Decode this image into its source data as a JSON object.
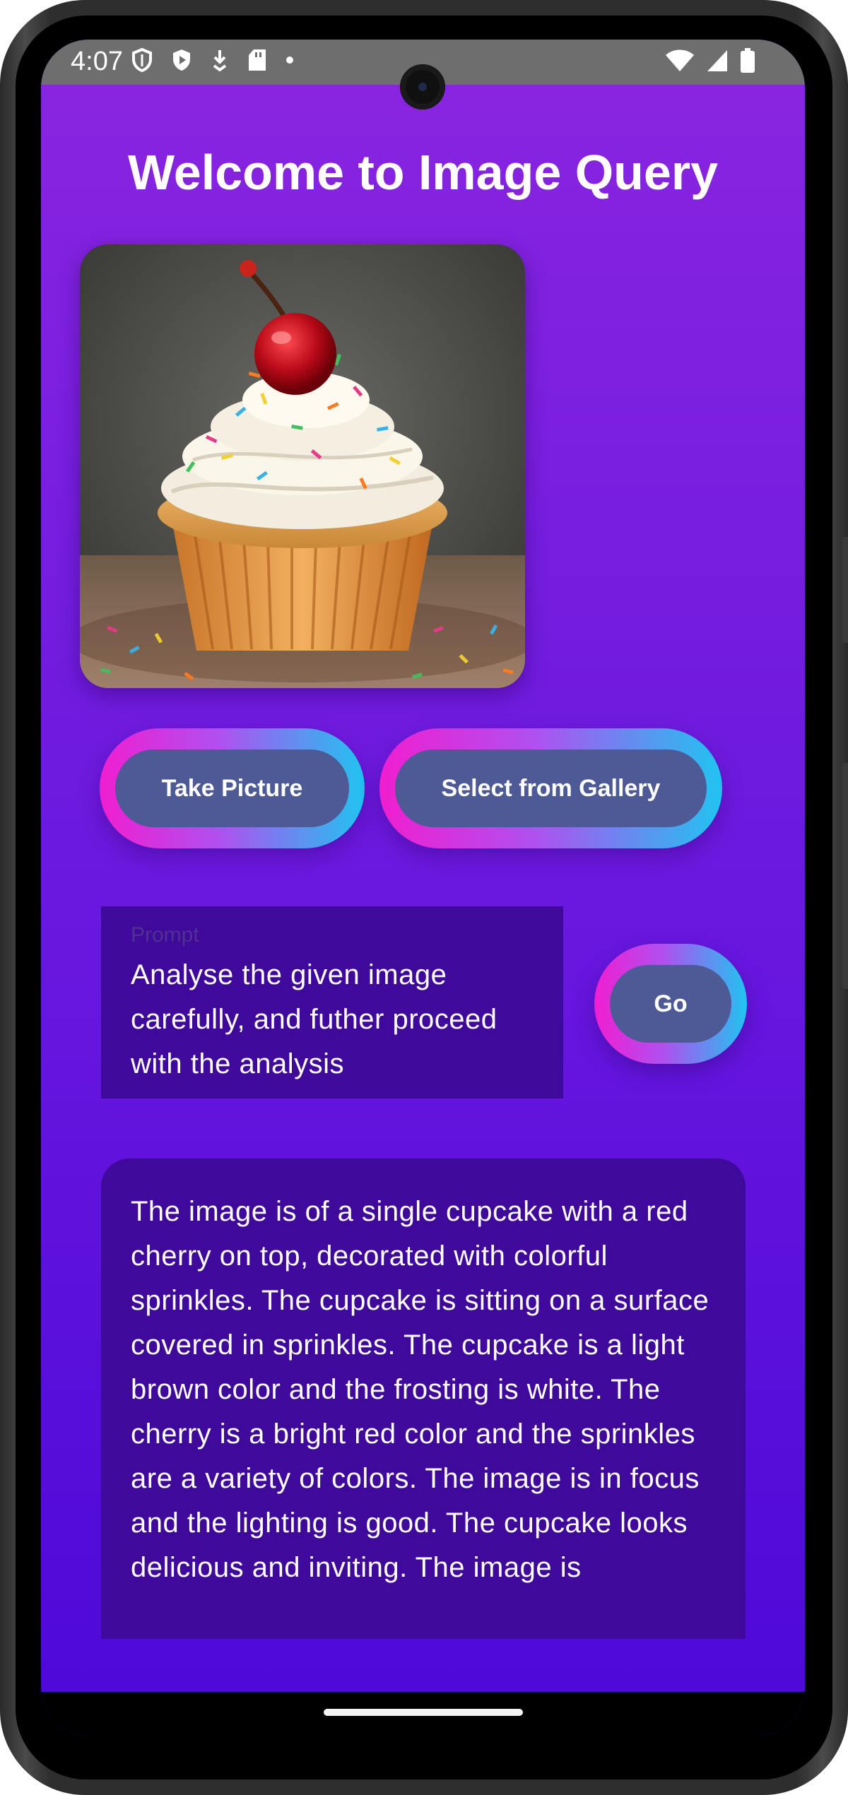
{
  "status_bar": {
    "time": "4:07",
    "left_icons": [
      "shield-outline-icon",
      "shield-play-icon",
      "download-icon",
      "sd-card-icon",
      "dot-icon"
    ],
    "right_icons": [
      "wifi-icon",
      "signal-icon",
      "battery-icon"
    ]
  },
  "header": {
    "title": "Welcome to Image Query"
  },
  "image_preview": {
    "subject": "cupcake-photo"
  },
  "buttons": {
    "take_picture": "Take Picture",
    "select_gallery": "Select from Gallery",
    "go": "Go"
  },
  "prompt": {
    "label": "Prompt",
    "value": "Analyse the given image carefully, and futher proceed with the analysis"
  },
  "result": {
    "text": "The image is of a single cupcake with a red cherry on top, decorated with colorful sprinkles.  The cupcake is sitting on a surface covered in sprinkles.  The cupcake is a light brown color and the frosting is white.  The cherry is a bright red color and the sprinkles are a variety of colors.  The image is in focus and the lighting is good. The cupcake looks delicious and inviting. The image is"
  },
  "colors": {
    "background_top": "#8a25e0",
    "background_bottom": "#4d08d8",
    "panel": "#3f0a9c",
    "button_fill": "#4e5a96",
    "ring_pink": "#f01ed0",
    "ring_cyan": "#20c4f0"
  }
}
